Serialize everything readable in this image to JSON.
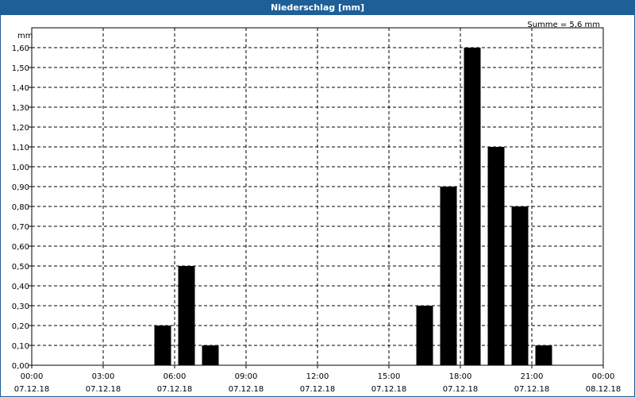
{
  "window": {
    "title": "Niederschlag [mm]"
  },
  "chart_data": {
    "type": "bar",
    "title": "Niederschlag [mm]",
    "ylabel": "mm",
    "summary": "Summe = 5,6 mm",
    "ylim": [
      0,
      1.7
    ],
    "yticks": [
      "0,00",
      "0,10",
      "0,20",
      "0,30",
      "0,40",
      "0,50",
      "0,60",
      "0,70",
      "0,80",
      "0,90",
      "1,00",
      "1,10",
      "1,20",
      "1,30",
      "1,40",
      "1,50",
      "1,60"
    ],
    "xrange_hours": [
      0,
      24
    ],
    "xticks": [
      {
        "time": "00:00",
        "date": "07.12.18",
        "hour": 0
      },
      {
        "time": "03:00",
        "date": "07.12.18",
        "hour": 3
      },
      {
        "time": "06:00",
        "date": "07.12.18",
        "hour": 6
      },
      {
        "time": "09:00",
        "date": "07.12.18",
        "hour": 9
      },
      {
        "time": "12:00",
        "date": "07.12.18",
        "hour": 12
      },
      {
        "time": "15:00",
        "date": "07.12.18",
        "hour": 15
      },
      {
        "time": "18:00",
        "date": "07.12.18",
        "hour": 18
      },
      {
        "time": "21:00",
        "date": "07.12.18",
        "hour": 21
      },
      {
        "time": "00:00",
        "date": "08.12.18",
        "hour": 24
      }
    ],
    "bars": [
      {
        "hour": 5.5,
        "value": 0.2
      },
      {
        "hour": 6.5,
        "value": 0.5
      },
      {
        "hour": 7.5,
        "value": 0.1
      },
      {
        "hour": 16.5,
        "value": 0.3
      },
      {
        "hour": 17.5,
        "value": 0.9
      },
      {
        "hour": 18.5,
        "value": 1.6
      },
      {
        "hour": 19.5,
        "value": 1.1
      },
      {
        "hour": 20.5,
        "value": 0.8
      },
      {
        "hour": 21.5,
        "value": 0.1
      }
    ],
    "grid": true,
    "bar_color": "#000000"
  }
}
